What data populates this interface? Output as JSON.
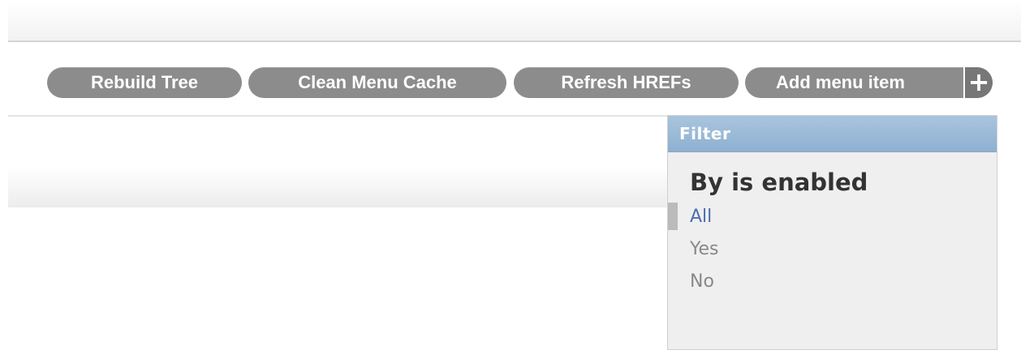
{
  "toolbar": {
    "rebuild_tree": "Rebuild Tree",
    "clean_menu_cache": "Clean Menu Cache",
    "refresh_hrefs": "Refresh HREFs",
    "add_menu_item": "Add menu item",
    "add_icon_glyph": "+"
  },
  "filter": {
    "title": "Filter",
    "heading": "By is enabled",
    "options": [
      {
        "label": "All",
        "selected": true
      },
      {
        "label": "Yes",
        "selected": false
      },
      {
        "label": "No",
        "selected": false
      }
    ]
  },
  "colors": {
    "button_bg": "#8c8c8c",
    "filter_header": "#99b9d6",
    "selected_link": "#4b6fae"
  }
}
